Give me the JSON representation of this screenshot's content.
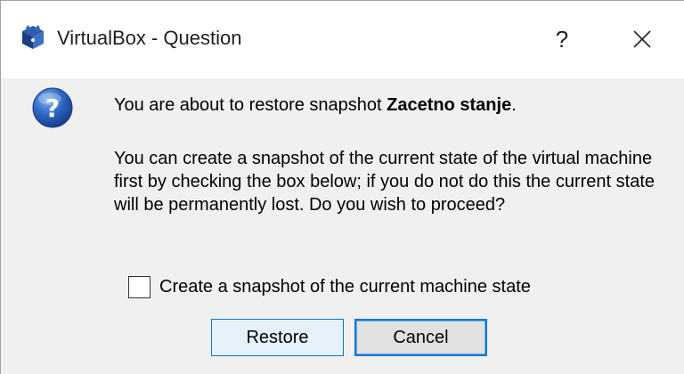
{
  "window": {
    "title": "VirtualBox - Question",
    "help_label": "?",
    "app_icon": "virtualbox-cube-icon",
    "close_icon": "close-icon"
  },
  "message": {
    "icon": "question-icon",
    "line1_prefix": "You are about to restore snapshot ",
    "snapshot_name": "Zacetno stanje",
    "line1_suffix": ".",
    "line2": "You can create a snapshot of the current state of the virtual machine first by checking the box below; if you do not do this the current state will be permanently lost. Do you wish to proceed?"
  },
  "checkbox": {
    "label": "Create a snapshot of the current machine state",
    "checked": false
  },
  "buttons": {
    "restore": "Restore",
    "cancel": "Cancel"
  },
  "colors": {
    "accent": "#0078d7",
    "default_button_bg": "#e5f1fb"
  }
}
